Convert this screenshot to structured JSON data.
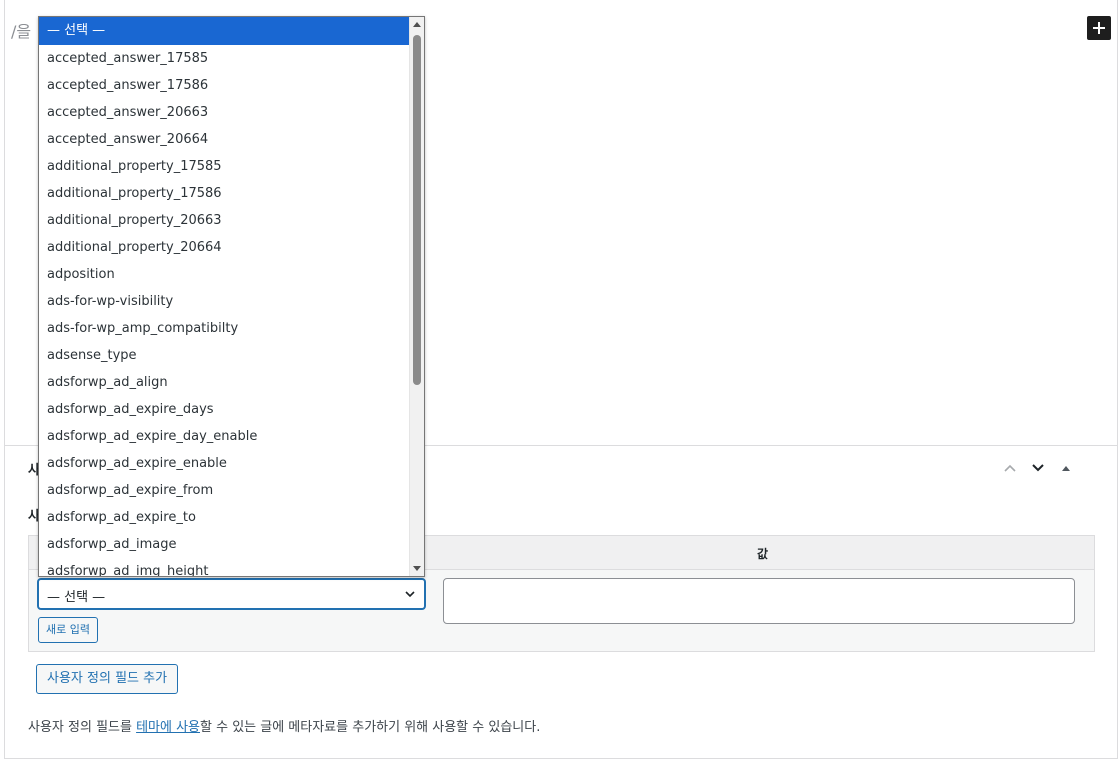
{
  "editor": {
    "slash_text": "/을"
  },
  "panel": {
    "title": "사",
    "subtitle": "사",
    "table": {
      "value_header": "값",
      "key_select_value": "— 선택 —",
      "new_entry_label": "새로 입력"
    },
    "add_field_label": "사용자 정의 필드 추가",
    "help": {
      "before": "사용자 정의 필드를 ",
      "link": "테마에 사용",
      "after": "할 수 있는 글에 메타자료를 추가하기 위해 사용할 수 있습니다."
    }
  },
  "dropdown": {
    "options": [
      "— 선택 —",
      "accepted_answer_17585",
      "accepted_answer_17586",
      "accepted_answer_20663",
      "accepted_answer_20664",
      "additional_property_17585",
      "additional_property_17586",
      "additional_property_20663",
      "additional_property_20664",
      "adposition",
      "ads-for-wp-visibility",
      "ads-for-wp_amp_compatibilty",
      "adsense_type",
      "adsforwp_ad_align",
      "adsforwp_ad_expire_days",
      "adsforwp_ad_expire_day_enable",
      "adsforwp_ad_expire_enable",
      "adsforwp_ad_expire_from",
      "adsforwp_ad_expire_to",
      "adsforwp_ad_image",
      "adsforwp_ad_img_height"
    ]
  },
  "icons": {
    "add_block": "plus-icon",
    "move_up": "chevron-up-icon",
    "move_down": "chevron-down-icon",
    "toggle": "triangle-up-icon"
  },
  "colors": {
    "accent": "#2271b1",
    "selected_option": "#1967d2"
  }
}
